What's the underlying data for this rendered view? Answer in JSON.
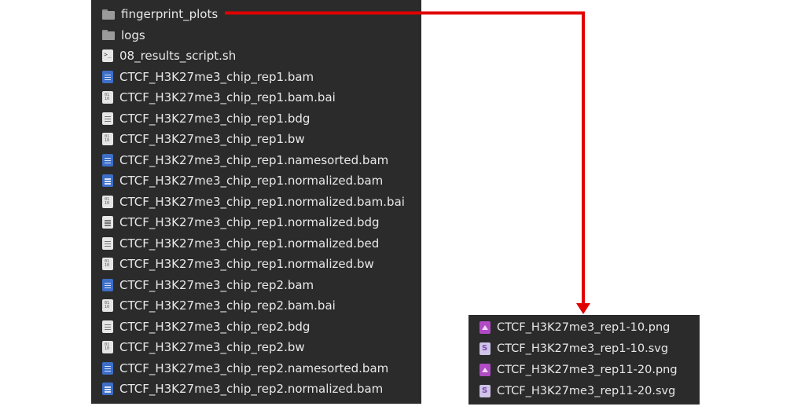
{
  "left_panel": {
    "items": [
      {
        "label": "fingerprint_plots",
        "icon": "folder-icon"
      },
      {
        "label": "logs",
        "icon": "folder-icon"
      },
      {
        "label": "08_results_script.sh",
        "icon": "script-file-icon"
      },
      {
        "label": "CTCF_H3K27me3_chip_rep1.bam",
        "icon": "bam-file-icon"
      },
      {
        "label": "CTCF_H3K27me3_chip_rep1.bam.bai",
        "icon": "binary-file-icon"
      },
      {
        "label": "CTCF_H3K27me3_chip_rep1.bdg",
        "icon": "text-file-icon"
      },
      {
        "label": "CTCF_H3K27me3_chip_rep1.bw",
        "icon": "binary-file-icon"
      },
      {
        "label": "CTCF_H3K27me3_chip_rep1.namesorted.bam",
        "icon": "bam-file-icon"
      },
      {
        "label": "CTCF_H3K27me3_chip_rep1.normalized.bam",
        "icon": "bam-file-icon"
      },
      {
        "label": "CTCF_H3K27me3_chip_rep1.normalized.bam.bai",
        "icon": "binary-file-icon"
      },
      {
        "label": "CTCF_H3K27me3_chip_rep1.normalized.bdg",
        "icon": "text-file-icon"
      },
      {
        "label": "CTCF_H3K27me3_chip_rep1.normalized.bed",
        "icon": "text-file-icon"
      },
      {
        "label": "CTCF_H3K27me3_chip_rep1.normalized.bw",
        "icon": "binary-file-icon"
      },
      {
        "label": "CTCF_H3K27me3_chip_rep2.bam",
        "icon": "bam-file-icon"
      },
      {
        "label": "CTCF_H3K27me3_chip_rep2.bam.bai",
        "icon": "binary-file-icon"
      },
      {
        "label": "CTCF_H3K27me3_chip_rep2.bdg",
        "icon": "text-file-icon"
      },
      {
        "label": "CTCF_H3K27me3_chip_rep2.bw",
        "icon": "binary-file-icon"
      },
      {
        "label": "CTCF_H3K27me3_chip_rep2.namesorted.bam",
        "icon": "bam-file-icon"
      },
      {
        "label": "CTCF_H3K27me3_chip_rep2.normalized.bam",
        "icon": "bam-file-icon"
      }
    ]
  },
  "right_panel": {
    "items": [
      {
        "label": "CTCF_H3K27me3_rep1-10.png",
        "icon": "image-file-icon"
      },
      {
        "label": "CTCF_H3K27me3_rep1-10.svg",
        "icon": "svg-file-icon"
      },
      {
        "label": "CTCF_H3K27me3_rep11-20.png",
        "icon": "image-file-icon"
      },
      {
        "label": "CTCF_H3K27me3_rep11-20.svg",
        "icon": "svg-file-icon"
      }
    ]
  },
  "colors": {
    "panel_bg": "#2b2b2b",
    "text": "#e8e8e8",
    "arrow": "#e00000"
  }
}
